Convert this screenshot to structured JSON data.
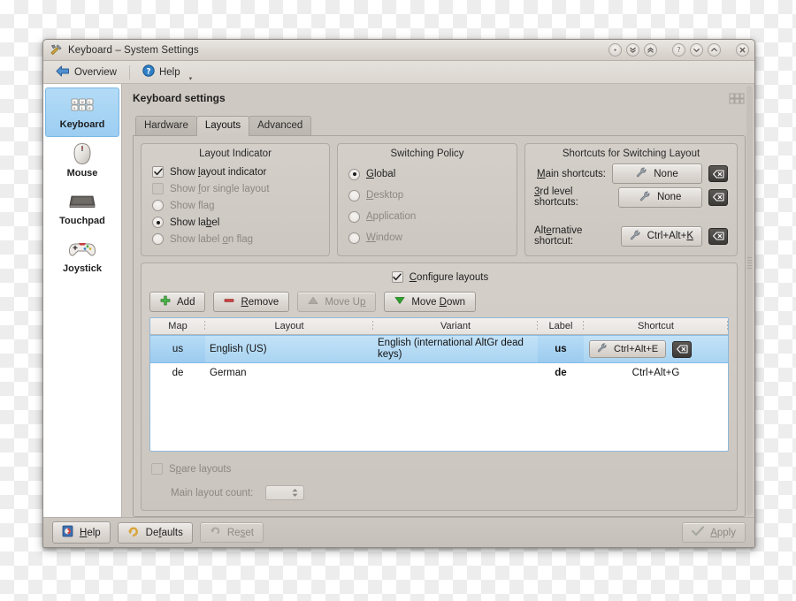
{
  "window": {
    "title": "Keyboard – System Settings",
    "app_icon": "tools-icon",
    "titlebar_buttons": [
      {
        "name": "shade-button",
        "glyph": "·"
      },
      {
        "name": "keep-below-button",
        "glyph": "chevrons-down"
      },
      {
        "name": "keep-above-button",
        "glyph": "chevrons-up"
      },
      {
        "name": "help-button",
        "glyph": "?"
      },
      {
        "name": "minimize-button",
        "glyph": "chevron-down"
      },
      {
        "name": "maximize-button",
        "glyph": "chevron-up"
      },
      {
        "name": "close-button",
        "glyph": "×"
      }
    ]
  },
  "toolbar": {
    "overview_label": "Overview",
    "help_label": "Help",
    "overview_icon": "back-arrow-icon",
    "help_icon": "help-circle-icon",
    "caret": "chevron-down-icon"
  },
  "sidebar": {
    "items": [
      {
        "label": "Keyboard",
        "icon": "keyboard-icon",
        "active": true
      },
      {
        "label": "Mouse",
        "icon": "mouse-icon",
        "active": false
      },
      {
        "label": "Touchpad",
        "icon": "touchpad-icon",
        "active": false
      },
      {
        "label": "Joystick",
        "icon": "joystick-icon",
        "active": false
      }
    ]
  },
  "main": {
    "page_title": "Keyboard settings",
    "corner_icon": "keyboard-mini-icon",
    "tabs": [
      {
        "label": "Hardware",
        "active": false
      },
      {
        "label": "Layouts",
        "active": true
      },
      {
        "label": "Advanced",
        "active": false
      }
    ]
  },
  "layout_indicator": {
    "title": "Layout Indicator",
    "options": [
      {
        "label": "Show layout indicator",
        "type": "checkbox",
        "checked": true,
        "enabled": true
      },
      {
        "label": "Show for single layout",
        "type": "checkbox",
        "checked": false,
        "enabled": false
      },
      {
        "label": "Show flag",
        "type": "radio",
        "checked": false,
        "enabled": false
      },
      {
        "label": "Show label",
        "type": "radio",
        "checked": true,
        "enabled": true
      },
      {
        "label": "Show label on flag",
        "type": "radio",
        "checked": false,
        "enabled": false
      }
    ]
  },
  "switching_policy": {
    "title": "Switching Policy",
    "options": [
      {
        "label": "Global",
        "checked": true
      },
      {
        "label": "Desktop",
        "checked": false
      },
      {
        "label": "Application",
        "checked": false
      },
      {
        "label": "Window",
        "checked": false
      }
    ]
  },
  "shortcuts": {
    "title": "Shortcuts for Switching Layout",
    "rows": [
      {
        "label": "Main shortcuts:",
        "value": "None",
        "clear_icon": "clear-backspace-icon"
      },
      {
        "label": "3rd level shortcuts:",
        "value": "None",
        "clear_icon": "clear-backspace-icon"
      },
      {
        "label": "Alternative shortcut:",
        "value": "Ctrl+Alt+K",
        "clear_icon": "clear-backspace-icon"
      }
    ]
  },
  "configure": {
    "checkbox_label": "Configure layouts",
    "checked": true,
    "buttons": [
      {
        "label": "Add",
        "icon": "plus-icon",
        "enabled": true
      },
      {
        "label": "Remove",
        "icon": "minus-icon",
        "enabled": true
      },
      {
        "label": "Move Up",
        "icon": "triangle-up-icon",
        "enabled": false
      },
      {
        "label": "Move Down",
        "icon": "triangle-down-icon",
        "enabled": true
      }
    ],
    "table": {
      "columns": [
        "Map",
        "Layout",
        "Variant",
        "Label",
        "Shortcut"
      ],
      "rows": [
        {
          "map": "us",
          "layout": "English (US)",
          "variant": "English (international AltGr dead keys)",
          "label": "us",
          "shortcut": "Ctrl+Alt+E",
          "selected": true
        },
        {
          "map": "de",
          "layout": "German",
          "variant": "",
          "label": "de",
          "shortcut": "Ctrl+Alt+G",
          "selected": false
        }
      ]
    },
    "spare_label": "Spare layouts",
    "spare_checked": false,
    "main_count_label": "Main layout count:",
    "main_count_value": ""
  },
  "footer": {
    "help": "Help",
    "defaults": "Defaults",
    "reset": "Reset",
    "apply": "Apply",
    "help_icon": "help-book-icon",
    "defaults_icon": "undo-icon",
    "reset_icon": "reset-icon",
    "apply_icon": "check-icon"
  },
  "colors": {
    "selection": "#a9d4f2",
    "window_bg": "#cfc9c3",
    "sidebar_active": "#9ccef2",
    "accent_green": "#3faa3f",
    "accent_red": "#c8393b"
  }
}
